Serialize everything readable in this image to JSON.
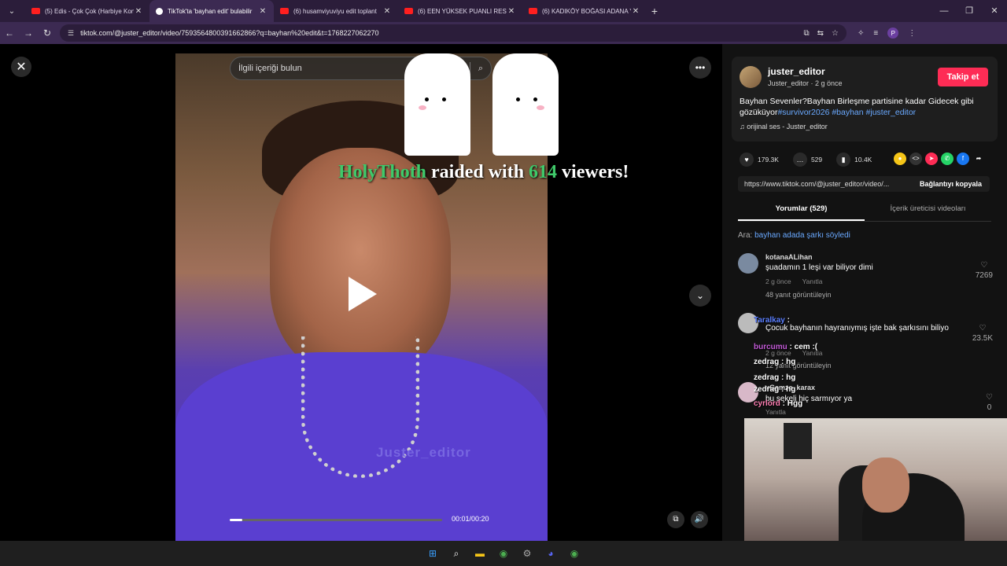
{
  "browser": {
    "tabs": [
      {
        "title": "(5) Edis - Çok Çok (Harbiye Kon",
        "icon": "youtube-icon"
      },
      {
        "title": "TikTok'ta 'bayhan edit' bulabilir",
        "icon": "tiktok-icon"
      },
      {
        "title": "(6) husamviyuviyu edit toplant",
        "icon": "youtube-icon"
      },
      {
        "title": "(6) EEN YÜKSEK PUANLI RESTO",
        "icon": "youtube-icon"
      },
      {
        "title": "(6) KADIKÖY BOĞASI ADANA Y",
        "icon": "youtube-icon"
      }
    ],
    "url": "tiktok.com/@juster_editor/video/7593564800391662866?q=bayhan%20edit&t=1768227062270"
  },
  "video": {
    "search_placeholder": "İlgili içeriği bulun",
    "watermark": "Juster_editor",
    "time": "00:01/00:20",
    "progress_fraction": 0.06
  },
  "raid": {
    "user": "HolyThoth",
    "mid": " raided with ",
    "count": "614",
    "end": " viewers!"
  },
  "author": {
    "name": "juster_editor",
    "sub": "Juster_editor · 2 g önce",
    "follow_label": "Takip et",
    "desc_text": "Bayhan Sevenler?Bayhan Birleşme partisine kadar Gidecek gibi gözüküyor",
    "desc_tags": "#survivor2026 #bayhan #juster_editor",
    "music": "orijinal ses - Juster_editor"
  },
  "stats": {
    "likes": "179.3K",
    "comments": "529",
    "saves": "10.4K"
  },
  "link": {
    "url": "https://www.tiktok.com/@juster_editor/video/...",
    "copy_label": "Bağlantıyı kopyala"
  },
  "tabs": {
    "comments": "Yorumlar (529)",
    "creator": "İçerik üreticisi videoları"
  },
  "search_hint": {
    "prefix": "Ara: ",
    "query": "bayhan adada şarkı söyledi"
  },
  "comments": [
    {
      "user": "kotanaALihan",
      "text": "şuadamın 1 leşi var biliyor dimi",
      "time": "2 g önce",
      "reply": "Yanıtla",
      "likes": "7269",
      "replies": "48 yanıt görüntüleyin"
    },
    {
      "user": "",
      "text": "Çocuk bayhanın hayranıymış işte bak şarkısını biliyo",
      "time": "2 g önce",
      "reply": "Yanıtla",
      "likes": "23.5K",
      "replies": "12 yanıt görüntüleyin"
    },
    {
      "user": "xGamze_karax",
      "text": "bu sekeli hiç sarmıyor ya",
      "time": "",
      "reply": "Yanıtla",
      "likes": "0",
      "replies": ""
    }
  ],
  "chat": [
    {
      "user": "Taralkay",
      "msg": " : "
    },
    {
      "user": "burcumu",
      "msg": " : cem :("
    },
    {
      "user": "zedrag",
      "msg": " : hg"
    },
    {
      "user": "zedrag",
      "msg": " : hg"
    },
    {
      "user": "zedrag",
      "msg": " : hg"
    },
    {
      "user": "cyrlord",
      "msg": " : Hgg"
    }
  ],
  "colors": {
    "accent": "#fe2c55",
    "link": "#6aa9ff",
    "raid_green": "#3fc96a",
    "tab_bg": "#2b1d3a"
  }
}
